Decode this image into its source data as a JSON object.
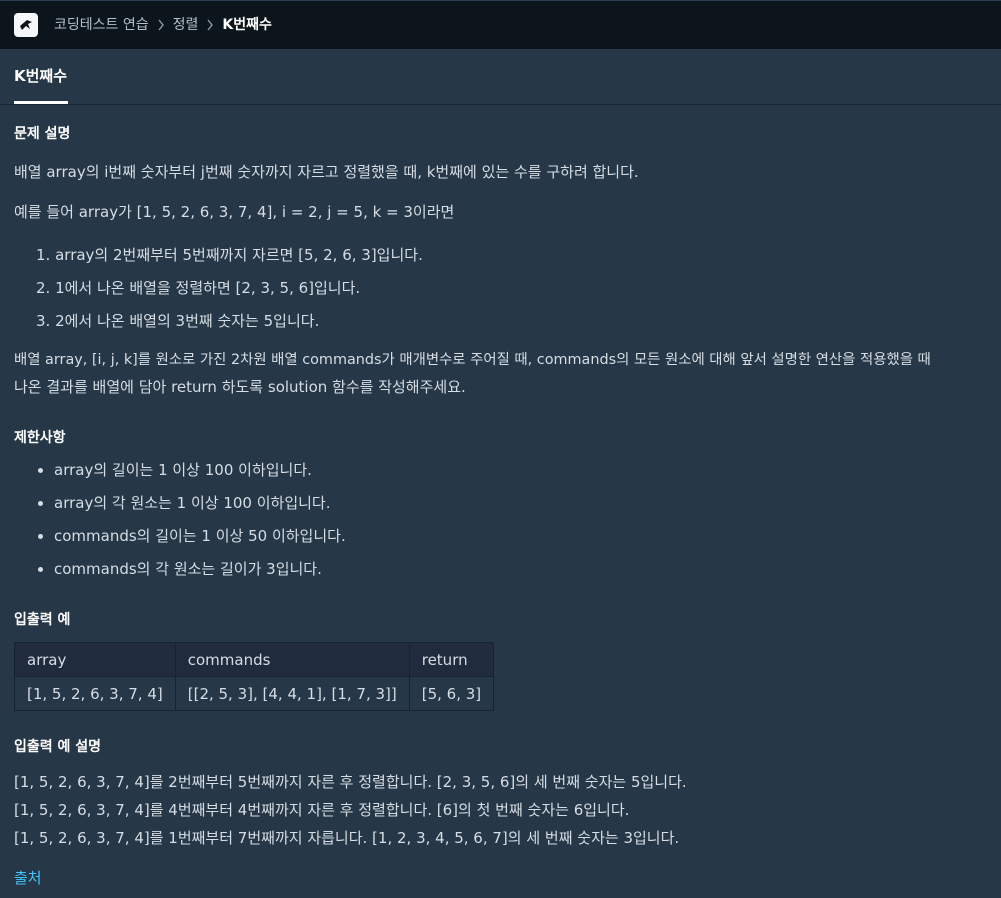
{
  "header": {
    "breadcrumb": [
      "코딩테스트 연습",
      "정렬",
      "K번째수"
    ]
  },
  "tab": {
    "title": "K번째수"
  },
  "description": {
    "heading": "문제 설명",
    "paragraph1": "배열 array의 i번째 숫자부터 j번째 숫자까지 자르고 정렬했을 때, k번째에 있는 수를 구하려 합니다.",
    "paragraph2": "예를 들어 array가 [1, 5, 2, 6, 3, 7, 4], i = 2, j = 5, k = 3이라면",
    "steps": [
      "array의 2번째부터 5번째까지 자르면 [5, 2, 6, 3]입니다.",
      "1에서 나온 배열을 정렬하면 [2, 3, 5, 6]입니다.",
      "2에서 나온 배열의 3번째 숫자는 5입니다."
    ],
    "step_numbers": [
      "1.",
      "2.",
      "3."
    ],
    "paragraph3_line1": "배열 array, [i, j, k]를 원소로 가진 2차원 배열 commands가 매개변수로 주어질 때, commands의 모든 원소에 대해 앞서 설명한 연산을 적용했을 때",
    "paragraph3_line2": "나온 결과를 배열에 담아 return 하도록 solution 함수를 작성해주세요."
  },
  "constraints": {
    "heading": "제한사항",
    "items": [
      "array의 길이는 1 이상 100 이하입니다.",
      "array의 각 원소는 1 이상 100 이하입니다.",
      "commands의 길이는 1 이상 50 이하입니다.",
      "commands의 각 원소는 길이가 3입니다."
    ]
  },
  "io_example": {
    "heading": "입출력 예",
    "columns": [
      "array",
      "commands",
      "return"
    ],
    "rows": [
      [
        "[1, 5, 2, 6, 3, 7, 4]",
        "[[2, 5, 3], [4, 4, 1], [1, 7, 3]]",
        "[5, 6, 3]"
      ]
    ]
  },
  "io_explanation": {
    "heading": "입출력 예 설명",
    "lines": [
      "[1, 5, 2, 6, 3, 7, 4]를 2번째부터 5번째까지 자른 후 정렬합니다. [2, 3, 5, 6]의 세 번째 숫자는 5입니다.",
      "[1, 5, 2, 6, 3, 7, 4]를 4번째부터 4번째까지 자른 후 정렬합니다. [6]의 첫 번째 숫자는 6입니다.",
      "[1, 5, 2, 6, 3, 7, 4]를 1번째부터 7번째까지 자릅니다. [1, 2, 3, 4, 5, 6, 7]의 세 번째 숫자는 3입니다."
    ]
  },
  "source_link": "출처",
  "colors": {
    "background": "#263747",
    "topbar": "#0c151c",
    "link": "#44c4fa"
  }
}
